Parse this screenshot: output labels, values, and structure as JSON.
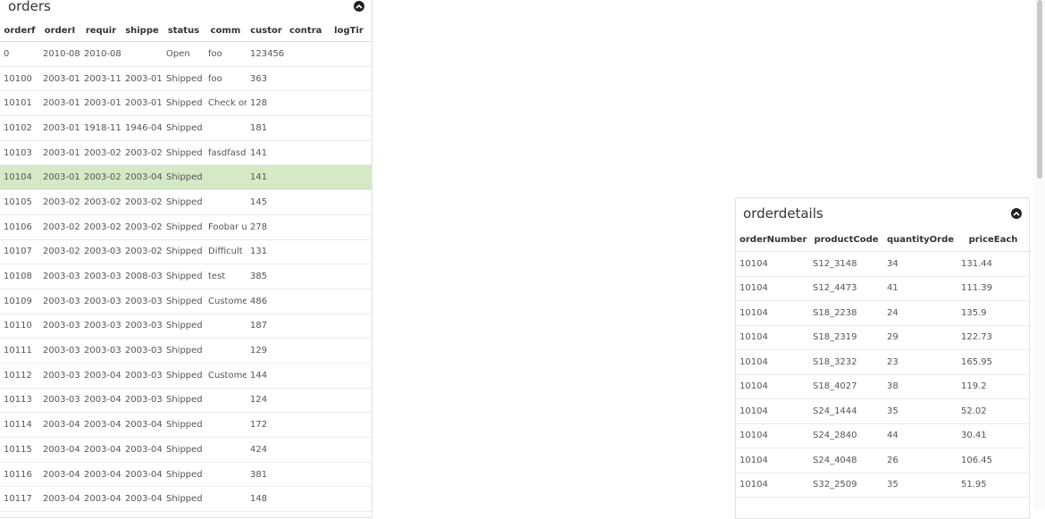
{
  "orders": {
    "title": "orders",
    "columns": [
      "orderf",
      "orderI",
      "requir",
      "shippe",
      "status",
      "comm",
      "custor",
      "contra",
      "logTir"
    ],
    "rows": [
      [
        "0",
        "2010-08-",
        "2010-08-",
        "",
        "Open",
        "foo",
        "123456",
        "",
        ""
      ],
      [
        "10100",
        "2003-01-",
        "2003-11-",
        "2003-01-",
        "Shipped",
        "foo",
        "363",
        "",
        ""
      ],
      [
        "10101",
        "2003-01-",
        "2003-01-",
        "2003-01-",
        "Shipped",
        "Check or",
        "128",
        "",
        ""
      ],
      [
        "10102",
        "2003-01-",
        "1918-11-",
        "1946-04-",
        "Shipped",
        "",
        "181",
        "",
        ""
      ],
      [
        "10103",
        "2003-01-",
        "2003-02-",
        "2003-02-",
        "Shipped",
        "fasdfasd",
        "141",
        "",
        ""
      ],
      [
        "10104",
        "2003-01-",
        "2003-02-",
        "2003-04-",
        "Shipped",
        "",
        "141",
        "",
        ""
      ],
      [
        "10105",
        "2003-02-",
        "2003-02-",
        "2003-02-",
        "Shipped",
        "",
        "145",
        "",
        ""
      ],
      [
        "10106",
        "2003-02-",
        "2003-02-",
        "2003-02-",
        "Shipped",
        "Foobar u",
        "278",
        "",
        ""
      ],
      [
        "10107",
        "2003-02-",
        "2003-03-",
        "2003-02-",
        "Shipped",
        "Difficult",
        "131",
        "",
        ""
      ],
      [
        "10108",
        "2003-03-",
        "2003-03-",
        "2008-03-",
        "Shipped",
        "test",
        "385",
        "",
        ""
      ],
      [
        "10109",
        "2003-03-",
        "2003-03-",
        "2003-03-",
        "Shipped",
        "Custome",
        "486",
        "",
        ""
      ],
      [
        "10110",
        "2003-03-",
        "2003-03-",
        "2003-03-",
        "Shipped",
        "",
        "187",
        "",
        ""
      ],
      [
        "10111",
        "2003-03-",
        "2003-03-",
        "2003-03-",
        "Shipped",
        "",
        "129",
        "",
        ""
      ],
      [
        "10112",
        "2003-03-",
        "2003-04-",
        "2003-03-",
        "Shipped",
        "Custome",
        "144",
        "",
        ""
      ],
      [
        "10113",
        "2003-03-",
        "2003-04-",
        "2003-03-",
        "Shipped",
        "",
        "124",
        "",
        ""
      ],
      [
        "10114",
        "2003-04-",
        "2003-04-",
        "2003-04-",
        "Shipped",
        "",
        "172",
        "",
        ""
      ],
      [
        "10115",
        "2003-04-",
        "2003-04-",
        "2003-04-",
        "Shipped",
        "",
        "424",
        "",
        ""
      ],
      [
        "10116",
        "2003-04-",
        "2003-04-",
        "2003-04-",
        "Shipped",
        "",
        "381",
        "",
        ""
      ],
      [
        "10117",
        "2003-04-",
        "2003-04-",
        "2003-04-",
        "Shipped",
        "",
        "148",
        "",
        ""
      ]
    ],
    "selected_row": 5
  },
  "orderdetails": {
    "title": "orderdetails",
    "columns": [
      "orderNumber",
      "productCode",
      "quantityOrde",
      "priceEach"
    ],
    "rows": [
      [
        "10104",
        "S12_3148",
        "34",
        "131.44"
      ],
      [
        "10104",
        "S12_4473",
        "41",
        "111.39"
      ],
      [
        "10104",
        "S18_2238",
        "24",
        "135.9"
      ],
      [
        "10104",
        "S18_2319",
        "29",
        "122.73"
      ],
      [
        "10104",
        "S18_3232",
        "23",
        "165.95"
      ],
      [
        "10104",
        "S18_4027",
        "38",
        "119.2"
      ],
      [
        "10104",
        "S24_1444",
        "35",
        "52.02"
      ],
      [
        "10104",
        "S24_2840",
        "44",
        "30.41"
      ],
      [
        "10104",
        "S24_4048",
        "26",
        "106.45"
      ],
      [
        "10104",
        "S32_2509",
        "35",
        "51.95"
      ]
    ]
  },
  "icons": {
    "collapse": "chevron-up-circle-icon"
  },
  "colors": {
    "selected_row": "#d5e9c6",
    "border": "#e2e2e2"
  }
}
